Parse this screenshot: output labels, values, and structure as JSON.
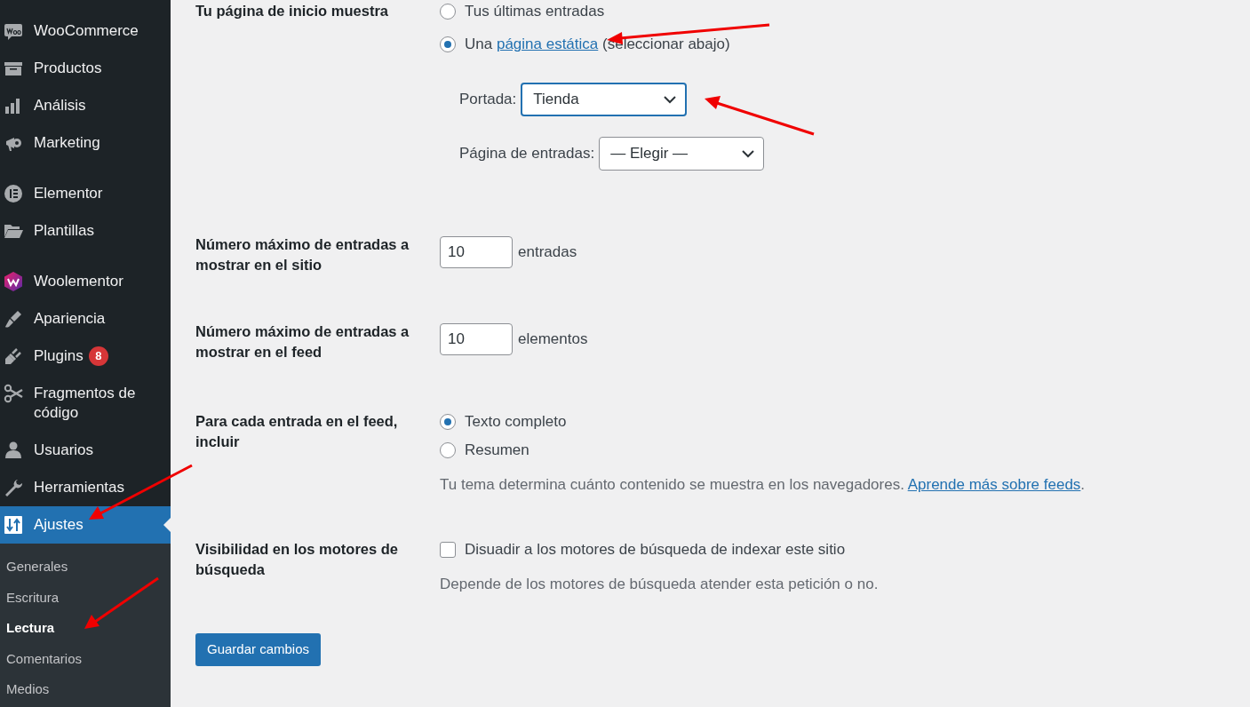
{
  "sidebar": {
    "groups": [
      {
        "items": [
          {
            "label": "WooCommerce",
            "selected": false
          },
          {
            "label": "Productos",
            "selected": false
          },
          {
            "label": "Análisis",
            "selected": false
          },
          {
            "label": "Marketing",
            "selected": false
          }
        ]
      },
      {
        "items": [
          {
            "label": "Elementor",
            "selected": false
          },
          {
            "label": "Plantillas",
            "selected": false
          }
        ]
      },
      {
        "items": [
          {
            "label": "Woolementor",
            "selected": false
          },
          {
            "label": "Apariencia",
            "selected": false
          },
          {
            "label": "Plugins",
            "selected": false,
            "badge": "8"
          },
          {
            "label": "Fragmentos de código",
            "selected": false
          },
          {
            "label": "Usuarios",
            "selected": false
          },
          {
            "label": "Herramientas",
            "selected": false
          },
          {
            "label": "Ajustes",
            "selected": true,
            "submenu": [
              {
                "label": "Generales",
                "selected": false
              },
              {
                "label": "Escritura",
                "selected": false
              },
              {
                "label": "Lectura",
                "selected": true
              },
              {
                "label": "Comentarios",
                "selected": false
              },
              {
                "label": "Medios",
                "selected": false
              }
            ]
          }
        ]
      }
    ]
  },
  "settings": [
    {
      "kind": "front_page",
      "label": "Tu página de inicio muestra",
      "options": [
        {
          "text": "Tus últimas entradas",
          "selected": false
        },
        {
          "text": "Una",
          "link": "página estática",
          "after_link": "(seleccionar abajo)",
          "selected": true
        }
      ],
      "selects": [
        {
          "label": "Portada:",
          "value": "Tienda",
          "focused": true
        },
        {
          "label": "Página de entradas:",
          "value": "— Elegir —",
          "focused": false
        }
      ]
    },
    {
      "kind": "number",
      "label": "Número máximo de entradas a mostrar en el sitio",
      "value": "10",
      "unit": "entradas"
    },
    {
      "kind": "number",
      "label": "Número máximo de entradas a mostrar en el feed",
      "value": "10",
      "unit": "elementos"
    },
    {
      "kind": "radio",
      "label": "Para cada entrada en el feed, incluir",
      "options": [
        {
          "text": "Texto completo",
          "selected": true
        },
        {
          "text": "Resumen",
          "selected": false
        }
      ],
      "description": "Tu tema determina cuánto contenido se muestra en los navegadores.",
      "link": "Aprende más sobre feeds",
      "after_link": "."
    },
    {
      "kind": "checkbox",
      "label": "Visibilidad en los motores de búsqueda",
      "option": "Disuadir a los motores de búsqueda de indexar este sitio",
      "checked": false,
      "description": "Depende de los motores de búsqueda atender esta petición o no."
    }
  ],
  "save_button": "Guardar cambios"
}
